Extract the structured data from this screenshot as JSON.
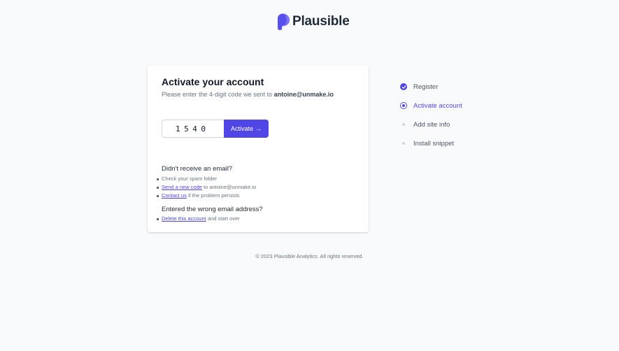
{
  "brand": {
    "name": "Plausible",
    "accent_color": "#5046e5"
  },
  "card": {
    "title": "Activate your account",
    "subtitle_prefix": "Please enter the 4-digit code we sent to",
    "email": "antoine@unmake.io",
    "code_value": "1540",
    "activate_label": "Activate",
    "activate_icon": "arrow-right-icon"
  },
  "no_email": {
    "title": "Didn't receive an email?",
    "item1": "Check your spam folder",
    "item2_link": "Send a new code",
    "item2_suffix": "to antoine@unmake.io",
    "item3_link": "Contact us",
    "item3_suffix": "if the problem persists"
  },
  "wrong_email": {
    "title": "Entered the wrong email address?",
    "item1_link": "Delete this account",
    "item1_suffix": "and start over"
  },
  "steps": [
    {
      "label": "Register",
      "status": "done"
    },
    {
      "label": "Activate account",
      "status": "current"
    },
    {
      "label": "Add site info",
      "status": "pending"
    },
    {
      "label": "Install snippet",
      "status": "pending"
    }
  ],
  "footer": {
    "text": "© 2023 Plausible Analytics. All rights reserved."
  }
}
